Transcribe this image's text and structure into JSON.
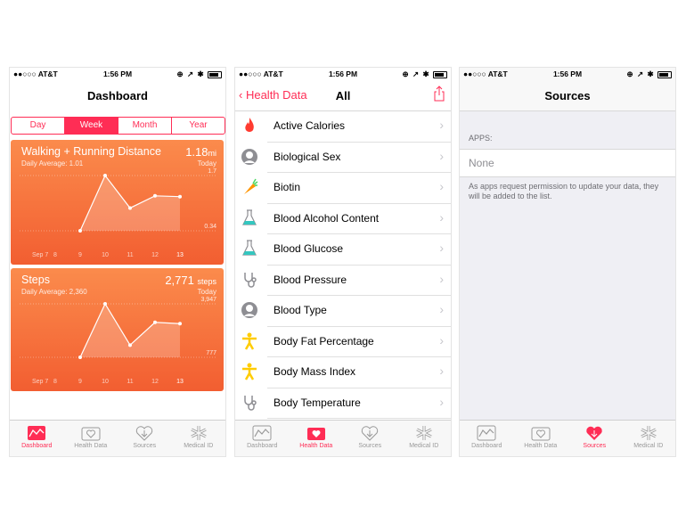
{
  "status": {
    "carrier": "●●○○○ AT&T",
    "time": "1:56 PM"
  },
  "colors": {
    "accent": "#ff2d55",
    "card_top": "#fb8b4c",
    "card_bottom": "#f25e31"
  },
  "dashboard": {
    "title": "Dashboard",
    "segments": [
      "Day",
      "Week",
      "Month",
      "Year"
    ],
    "active_segment": "Week",
    "cards": [
      {
        "title": "Walking + Running Distance",
        "value": "1.18",
        "unit": "mi",
        "average": "Daily Average: 1.01",
        "period": "Today",
        "y_top": "1.7",
        "y_bottom": "0.34",
        "x_labels": [
          "Sep 7",
          "8",
          "9",
          "10",
          "11",
          "12",
          "13"
        ],
        "chart_data": {
          "type": "line",
          "x": [
            "9",
            "10",
            "11",
            "12",
            "13"
          ],
          "values": [
            0.34,
            1.7,
            0.9,
            1.2,
            1.18
          ],
          "ylim": [
            0.34,
            1.7
          ]
        }
      },
      {
        "title": "Steps",
        "value": "2,771",
        "unit": "steps",
        "average": "Daily Average: 2,360",
        "period": "Today",
        "y_top": "3,947",
        "y_bottom": "777",
        "x_labels": [
          "Sep 7",
          "8",
          "9",
          "10",
          "11",
          "12",
          "13"
        ],
        "chart_data": {
          "type": "line",
          "x": [
            "9",
            "10",
            "11",
            "12",
            "13"
          ],
          "values": [
            777,
            3947,
            1500,
            2850,
            2771
          ],
          "ylim": [
            777,
            3947
          ]
        }
      }
    ]
  },
  "health_data": {
    "back": "Health Data",
    "title": "All",
    "items": [
      {
        "label": "Active Calories",
        "icon": "flame-icon"
      },
      {
        "label": "Biological Sex",
        "icon": "person-icon"
      },
      {
        "label": "Biotin",
        "icon": "carrot-icon"
      },
      {
        "label": "Blood Alcohol Content",
        "icon": "flask-icon"
      },
      {
        "label": "Blood Glucose",
        "icon": "flask-icon"
      },
      {
        "label": "Blood Pressure",
        "icon": "stethoscope-icon"
      },
      {
        "label": "Blood Type",
        "icon": "person-icon"
      },
      {
        "label": "Body Fat Percentage",
        "icon": "body-icon"
      },
      {
        "label": "Body Mass Index",
        "icon": "body-icon"
      },
      {
        "label": "Body Temperature",
        "icon": "stethoscope-icon"
      }
    ]
  },
  "sources": {
    "title": "Sources",
    "apps_header": "APPS:",
    "none": "None",
    "note": "As apps request permission to update your data, they will be added to the list."
  },
  "tabs": [
    "Dashboard",
    "Health Data",
    "Sources",
    "Medical ID"
  ]
}
